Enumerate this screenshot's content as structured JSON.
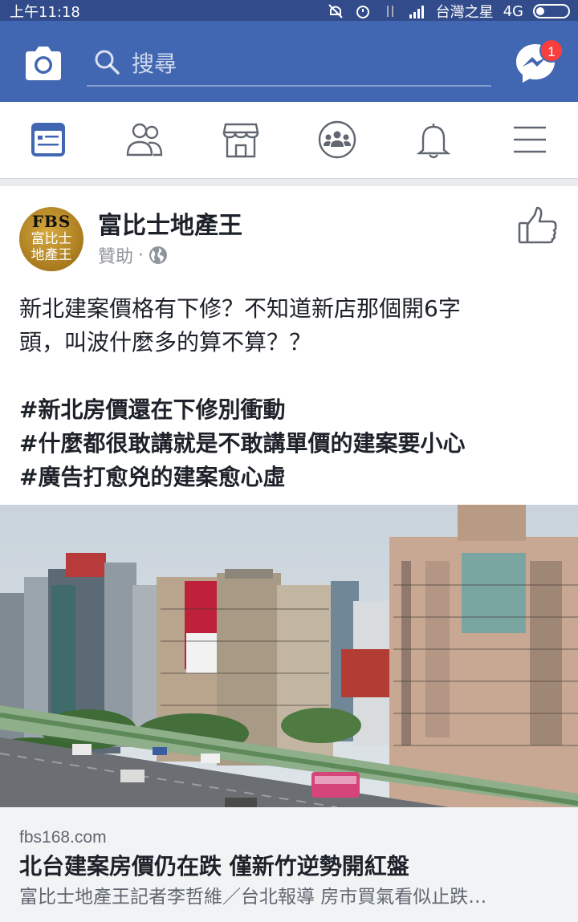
{
  "status_bar": {
    "time": "上午11:18",
    "carrier": "台灣之星",
    "network": "4G"
  },
  "header": {
    "search_placeholder": "搜尋",
    "messenger_badge": "1",
    "brand_color": "#4267b2"
  },
  "tabs": [
    {
      "icon": "news-feed-icon",
      "active": true
    },
    {
      "icon": "friends-icon"
    },
    {
      "icon": "marketplace-icon"
    },
    {
      "icon": "groups-icon"
    },
    {
      "icon": "notifications-icon"
    },
    {
      "icon": "menu-icon"
    }
  ],
  "post": {
    "avatar_top": "FBS",
    "avatar_line1": "富比士",
    "avatar_line2": "地產王",
    "page_name": "富比士地產王",
    "sponsored": "贊助",
    "separator": "·",
    "line1": "新北建案價格有下修？不知道新店那個開6字",
    "line2": "頭，叫波什麼多的算不算？？",
    "hashtags": [
      "#新北房價還在下修別衝動",
      "#什麼都很敢講就是不敢講單價的建案要小心",
      "#廣告打愈兇的建案愈心虛"
    ],
    "link": {
      "domain": "fbs168.com",
      "title": "北台建案房價仍在跌 僅新竹逆勢開紅盤",
      "description": "富比士地產王記者李哲維／台北報導 房市買氣看似止跌…"
    }
  }
}
